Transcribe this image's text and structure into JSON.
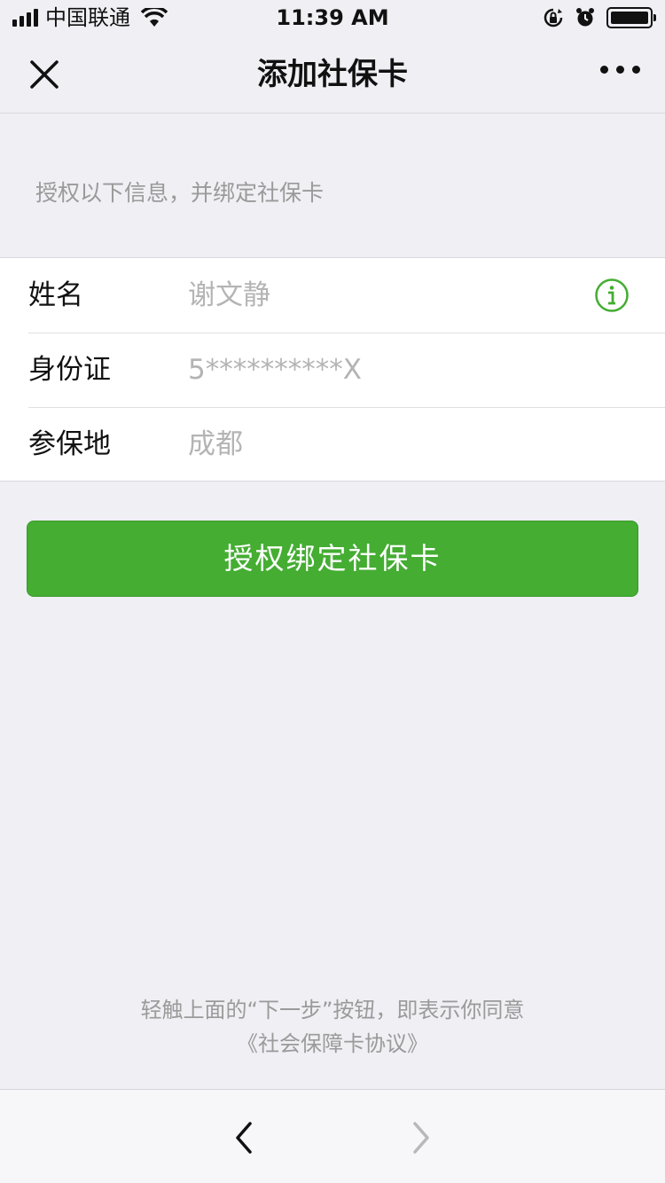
{
  "status_bar": {
    "carrier": "中国联通",
    "time": "11:39 AM",
    "icons": [
      "signal-icon",
      "wifi-icon",
      "orientation-lock-icon",
      "alarm-icon",
      "battery-icon"
    ]
  },
  "nav": {
    "title": "添加社保卡",
    "close_icon": "close-icon",
    "more_icon": "more-icon"
  },
  "hint": "授权以下信息，并绑定社保卡",
  "form": {
    "rows": [
      {
        "label": "姓名",
        "value": "谢文静"
      },
      {
        "label": "身份证",
        "value": "5**********X"
      },
      {
        "label": "参保地",
        "value": "成都"
      }
    ],
    "info_icon": "info-icon"
  },
  "button": {
    "label": "授权绑定社保卡"
  },
  "agreement": {
    "line1": "轻触上面的“下一步”按钮，即表示你同意",
    "line2": "《社会保障卡协议》"
  },
  "toolbar": {
    "back_icon": "back-icon",
    "forward_icon": "forward-icon"
  },
  "colors": {
    "accent": "#44ad32",
    "background": "#efeff4",
    "placeholder": "#b4b4b4"
  }
}
